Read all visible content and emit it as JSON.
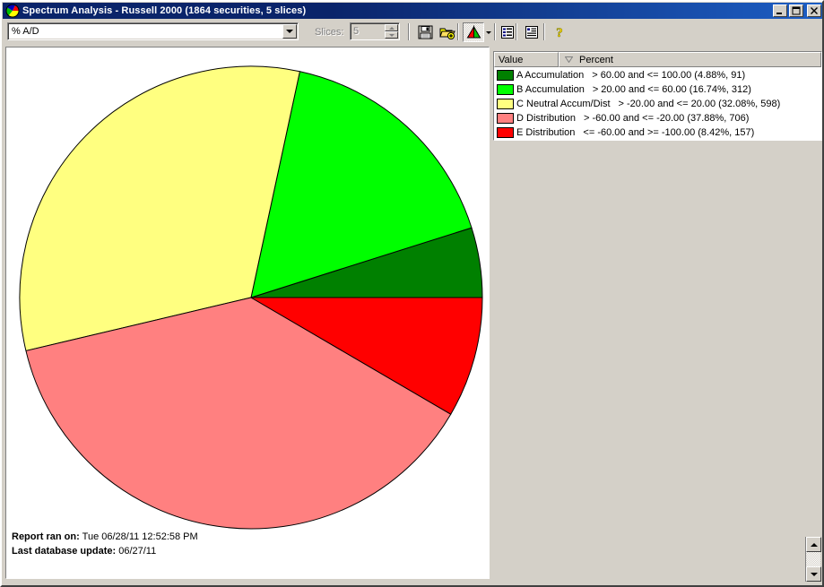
{
  "window": {
    "title": "Spectrum Analysis - Russell 2000 (1864 securities, 5 slices)",
    "app_icon": "pie-chart-icon",
    "minimize_label": "_",
    "maximize_label": "□",
    "close_label": "×"
  },
  "toolbar": {
    "measure_select": {
      "value": "% A/D",
      "name": "measure-dropdown"
    },
    "slices": {
      "label": "Slices:",
      "value": "5",
      "disabled": true
    },
    "buttons": [
      {
        "name": "save-button",
        "icon": "floppy-disk-icon",
        "label": "Save"
      },
      {
        "name": "open-button",
        "icon": "open-folder-icon",
        "label": "Open"
      },
      {
        "name": "chart-type-button",
        "icon": "pie-chart-icon",
        "label": "Chart Type",
        "pressed": true
      },
      {
        "name": "chart-type-dropdown",
        "icon": "chevron-down-icon",
        "label": "Chart Type Options"
      },
      {
        "name": "list-view-button",
        "icon": "list-icon",
        "label": "List View"
      },
      {
        "name": "report-button",
        "icon": "report-icon",
        "label": "Report"
      },
      {
        "name": "help-button",
        "icon": "question-mark-icon",
        "label": "Help"
      }
    ]
  },
  "legend": {
    "columns": [
      {
        "key": "value",
        "label": "Value"
      },
      {
        "key": "percent",
        "label": "Percent",
        "sort": "descending"
      }
    ],
    "rows": [
      {
        "label": "A Accumulation",
        "range": "> 60.00 and <= 100.00 (4.88%, 91)",
        "color": "#008000"
      },
      {
        "label": "B Accumulation",
        "range": "> 20.00 and <= 60.00 (16.74%, 312)",
        "color": "#00FF00"
      },
      {
        "label": "C Neutral Accum/Dist",
        "range": "> -20.00 and <= 20.00 (32.08%, 598)",
        "color": "#FFFF80"
      },
      {
        "label": "D Distribution",
        "range": "> -60.00 and <= -20.00 (37.88%, 706)",
        "color": "#FF8080"
      },
      {
        "label": "E Distribution",
        "range": "<= -60.00 and >= -100.00 (8.42%, 157)",
        "color": "#FF0000"
      }
    ]
  },
  "report": {
    "ran_on_label": "Report ran on:",
    "ran_on_value": "Tue 06/28/11 12:52:58 PM",
    "updated_label": "Last database update:",
    "updated_value": "06/27/11"
  },
  "scrollbar": {
    "up_arrow": "scroll-up-icon",
    "down_arrow": "scroll-down-icon"
  },
  "chart_data": {
    "type": "pie",
    "title": "Spectrum Analysis - Russell 2000",
    "total_securities": 1864,
    "slice_count": 5,
    "start_angle_deg": 0,
    "direction": "counterclockwise",
    "center": [
      278,
      330
    ],
    "radius": 258,
    "categories": [
      "A Accumulation",
      "B Accumulation",
      "C Neutral Accum/Dist",
      "D Distribution",
      "E Distribution"
    ],
    "values": [
      4.88,
      16.74,
      32.08,
      37.88,
      8.42
    ],
    "counts": [
      91,
      312,
      598,
      706,
      157
    ],
    "colors": [
      "#008000",
      "#00FF00",
      "#FFFF80",
      "#FF8080",
      "#FF0000"
    ],
    "ranges": [
      "> 60.00 and <= 100.00",
      "> 20.00 and <= 60.00",
      "> -20.00 and <= 20.00",
      "> -60.00 and <= -20.00",
      "<= -60.00 and >= -100.00"
    ],
    "ylabel": "",
    "xlabel": "",
    "legend_position": "right",
    "grid": false
  }
}
